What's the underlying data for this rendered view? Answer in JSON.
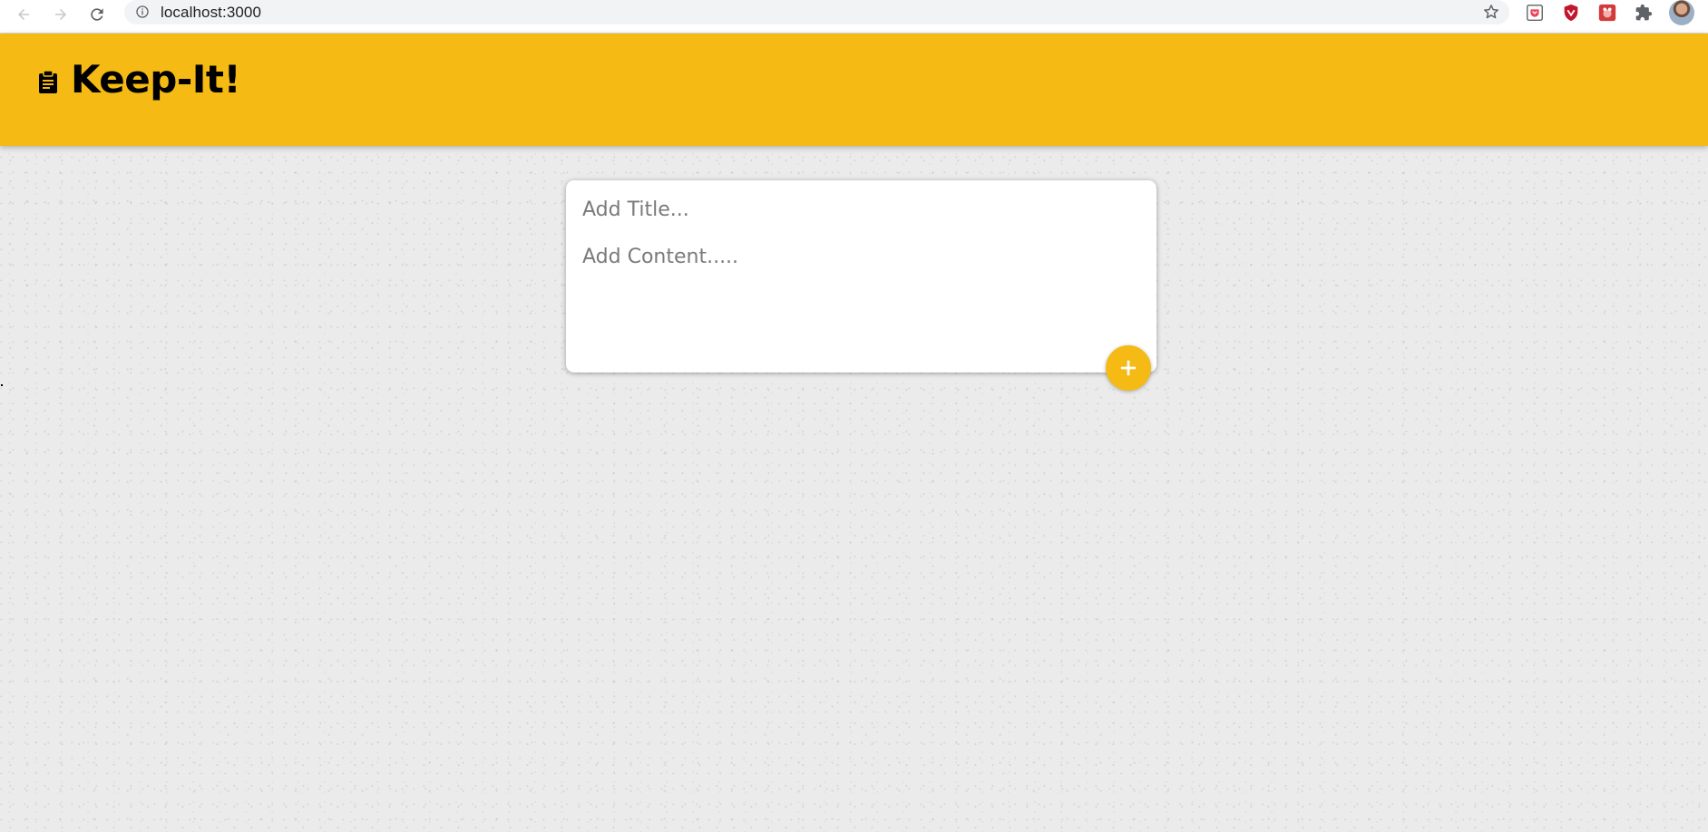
{
  "browser": {
    "url": "localhost:3000",
    "icons": [
      "back-arrow-icon",
      "forward-arrow-icon",
      "reload-icon",
      "info-icon",
      "star-icon",
      "pocket-extension-icon",
      "shield-extension-icon",
      "red-extension-icon",
      "puzzle-extensions-icon",
      "profile-avatar"
    ]
  },
  "header": {
    "title": "Keep-It!",
    "logo_icon": "clipboard-icon",
    "background_color": "#f5ba13"
  },
  "note_form": {
    "title_placeholder": "Add Title...",
    "title_value": "",
    "content_placeholder": "Add Content.....",
    "content_value": "",
    "add_button_label": "+",
    "add_button_icon": "plus-icon",
    "accent_color": "#f5ba13"
  }
}
